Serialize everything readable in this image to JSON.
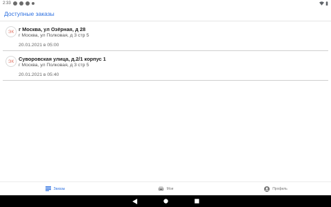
{
  "status_bar": {
    "time": "2:33"
  },
  "app_bar": {
    "title": "Доступные заказы"
  },
  "orders": [
    {
      "avatar": "ЭК",
      "address_from": "г Москва, ул Озёрная, д 28",
      "address_to": "г Москва, ул Полковая, д 3 стр 5",
      "datetime": "20.01.2021 в 05:00"
    },
    {
      "avatar": "ЭК",
      "address_from": "Суворовская улица, д.2/1 корпус 1",
      "address_to": "г Москва, ул Полковая, д 3 стр 5",
      "datetime": "20.01.2021 в 05:40"
    }
  ],
  "bottom_nav": {
    "items": [
      {
        "label": "Заказы",
        "icon": "list-icon",
        "active": true
      },
      {
        "label": "Мои",
        "icon": "car-icon",
        "active": false
      },
      {
        "label": "Профиль",
        "icon": "account-icon",
        "active": false
      }
    ]
  },
  "colors": {
    "accent": "#2a6ee0",
    "avatar_text": "#e27a6a"
  }
}
